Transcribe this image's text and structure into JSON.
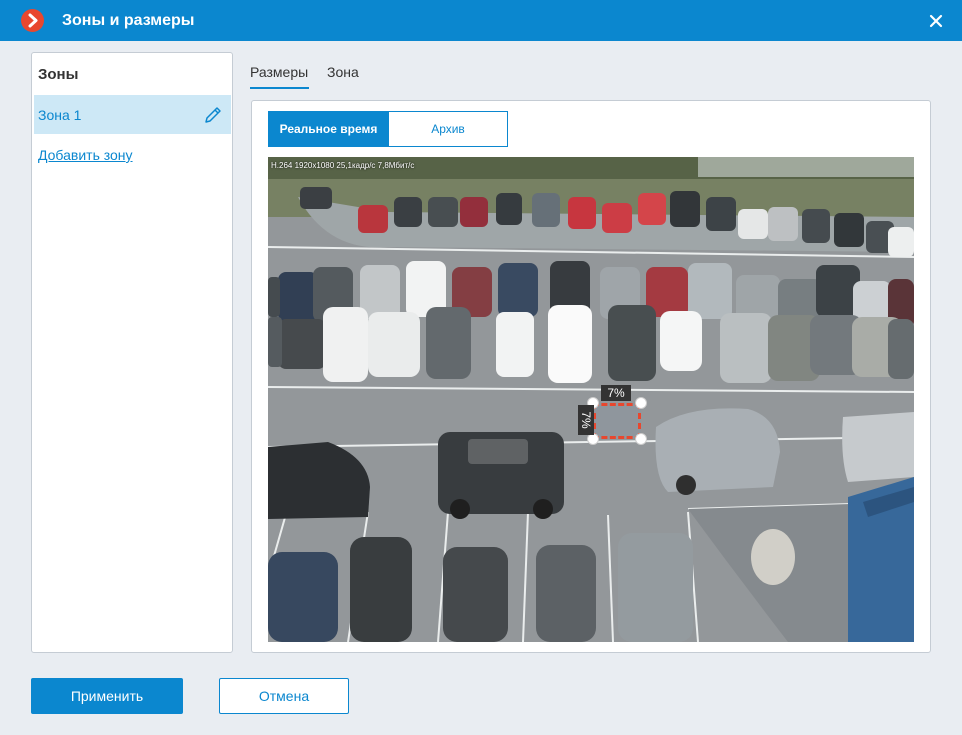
{
  "window": {
    "title": "Зоны и размеры",
    "close_icon": "close-icon",
    "app_icon": "app-logo-icon",
    "accent": "#0b87cf",
    "logo_color": "#e8472e"
  },
  "zones": {
    "header": "Зоны",
    "items": [
      {
        "label": "Зона 1",
        "edit_icon": "pencil-icon",
        "selected": true
      }
    ],
    "add_label": "Добавить зону"
  },
  "tabs": [
    {
      "label": "Размеры",
      "active": true
    },
    {
      "label": "Зона",
      "active": false
    }
  ],
  "source": {
    "realtime_label": "Реальное время",
    "archive_label": "Архив",
    "selected": "Реальное время"
  },
  "video": {
    "stream_info": "H.264 1920x1080 25,1кадр/с 7,8Мбит/с",
    "size_width_label": "7%",
    "size_height_label": "7%"
  },
  "buttons": {
    "apply": "Применить",
    "cancel": "Отмена"
  }
}
